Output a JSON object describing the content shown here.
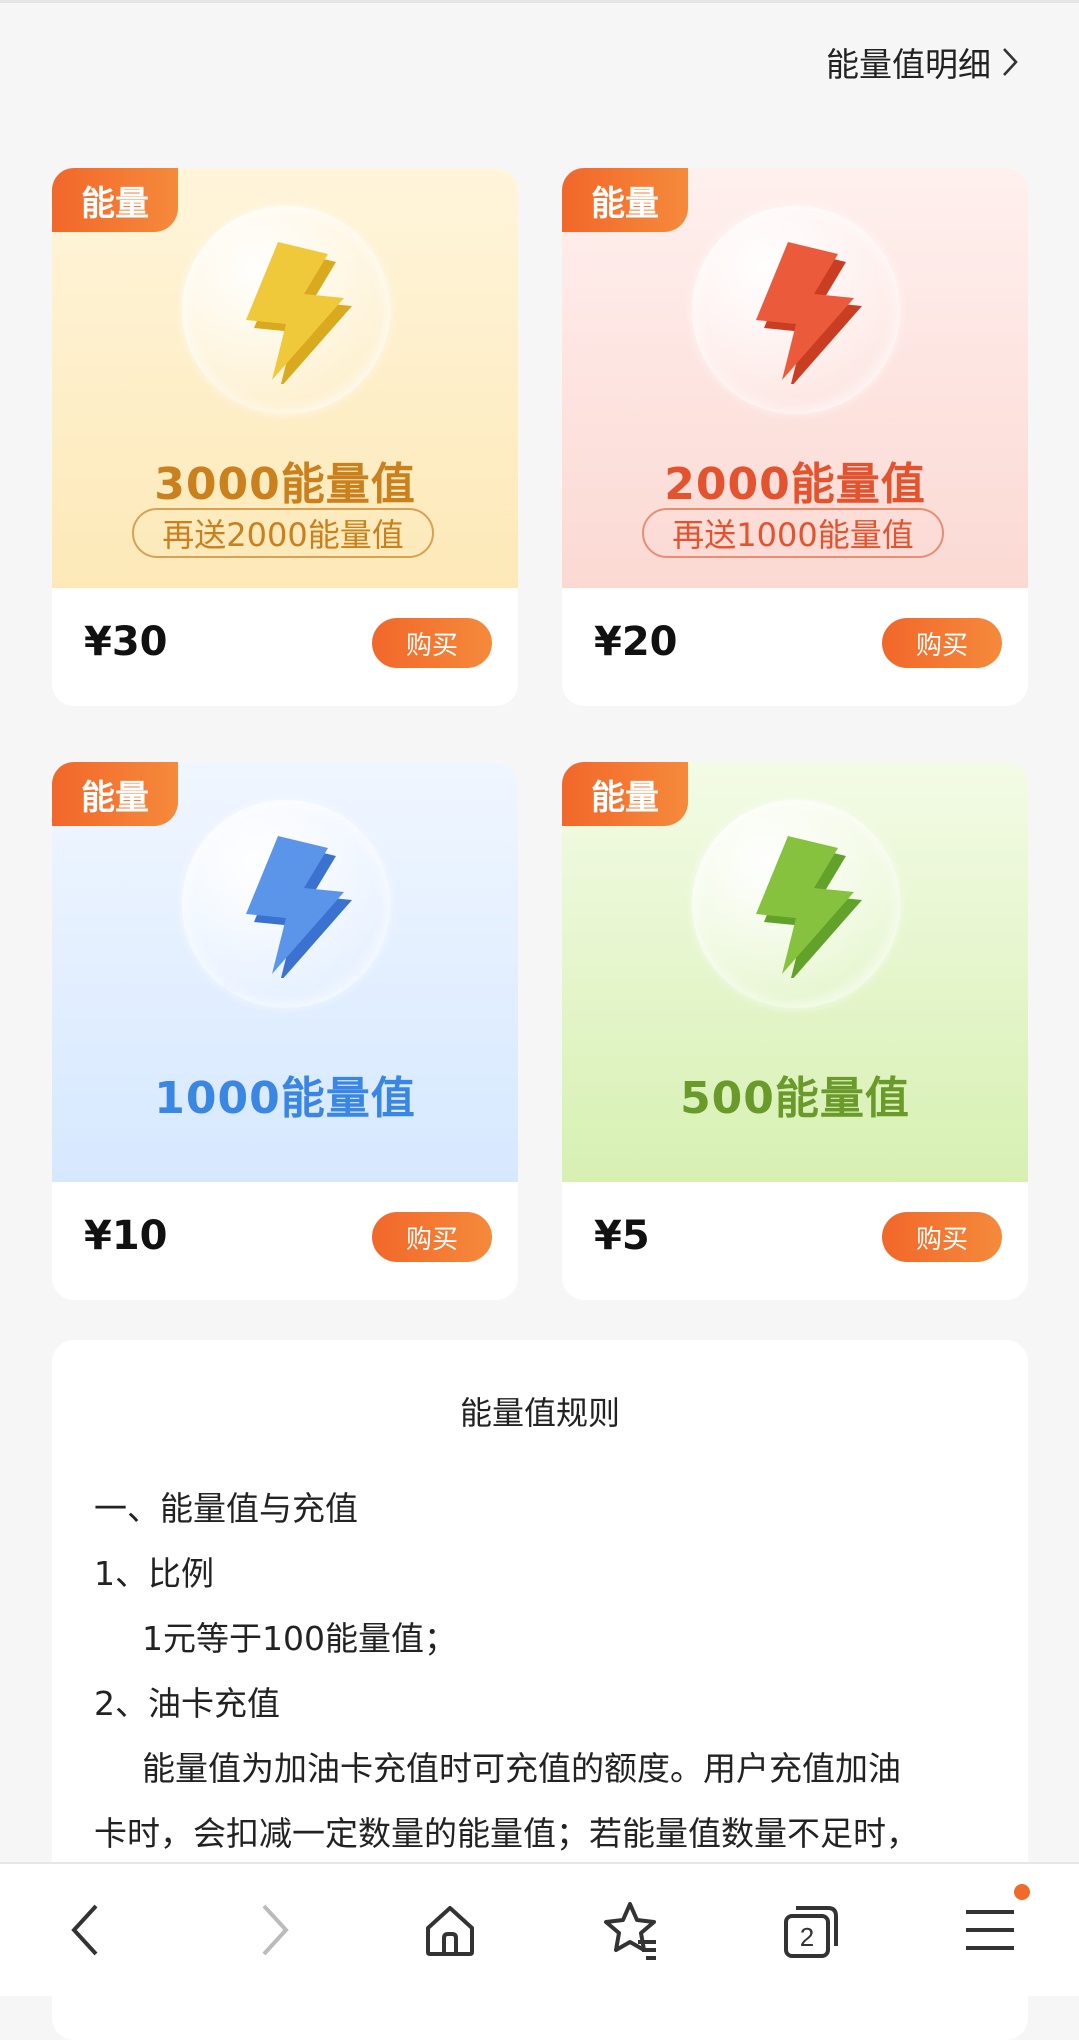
{
  "header": {
    "detail_link_label": "能量值明细"
  },
  "packages": [
    {
      "tag": "能量",
      "energy": "3000能量值",
      "bonus": "再送2000能量值",
      "price": "¥30",
      "buy_label": "购买",
      "bolt_color": "#f0c93a",
      "bolt_shade": "#d9a91f"
    },
    {
      "tag": "能量",
      "energy": "2000能量值",
      "bonus": "再送1000能量值",
      "price": "¥20",
      "buy_label": "购买",
      "bolt_color": "#ec5a3c",
      "bolt_shade": "#c93d22"
    },
    {
      "tag": "能量",
      "energy": "1000能量值",
      "bonus": "",
      "price": "¥10",
      "buy_label": "购买",
      "bolt_color": "#5a95ea",
      "bolt_shade": "#3b72cf"
    },
    {
      "tag": "能量",
      "energy": "500能量值",
      "bonus": "",
      "price": "¥5",
      "buy_label": "购买",
      "bolt_color": "#86c23e",
      "bolt_shade": "#62a12a"
    }
  ],
  "rules": {
    "title": "能量值规则",
    "lines": [
      "一、能量值与充值",
      "1、比例",
      "1元等于100能量值；",
      "2、油卡充值",
      "能量值为加油卡充值时可充值的额度。用户充值加油",
      "卡时，会扣减一定数量的能量值；若能量值数量不足时，"
    ]
  },
  "bottom_nav": {
    "icons": [
      "back-arrow-icon",
      "forward-arrow-icon",
      "home-icon",
      "bookmark-star-icon",
      "tabs-icon",
      "menu-icon"
    ],
    "tabs_count": "2"
  },
  "colors": {
    "accent": "#f2672a"
  }
}
